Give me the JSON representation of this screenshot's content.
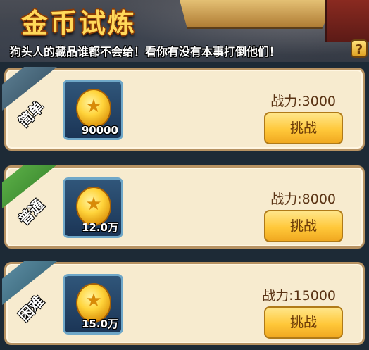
{
  "header": {
    "title": "金币试炼",
    "subtitle": "狗头人的藏品谁都不会给！看你有没有本事打倒他们！",
    "help_label": "?"
  },
  "levels": [
    {
      "difficulty": "简单",
      "reward_amount": "90000",
      "power": "战力:3000",
      "button_label": "挑战"
    },
    {
      "difficulty": "普通",
      "reward_amount": "12.0万",
      "power": "战力:8000",
      "button_label": "挑战"
    },
    {
      "difficulty": "困难",
      "reward_amount": "15.0万",
      "power": "战力:15000",
      "button_label": "挑战"
    }
  ],
  "icons": {
    "reward": "gold-coin-icon",
    "help": "question-mark-icon"
  },
  "colors": {
    "card_bg": "#f7ebcf",
    "button_gold": "#ffc83a",
    "title_gold": "#ffd95a",
    "ribbon_easy": "#3f5f73",
    "ribbon_normal": "#3f9535",
    "ribbon_hard": "#3f7288"
  }
}
